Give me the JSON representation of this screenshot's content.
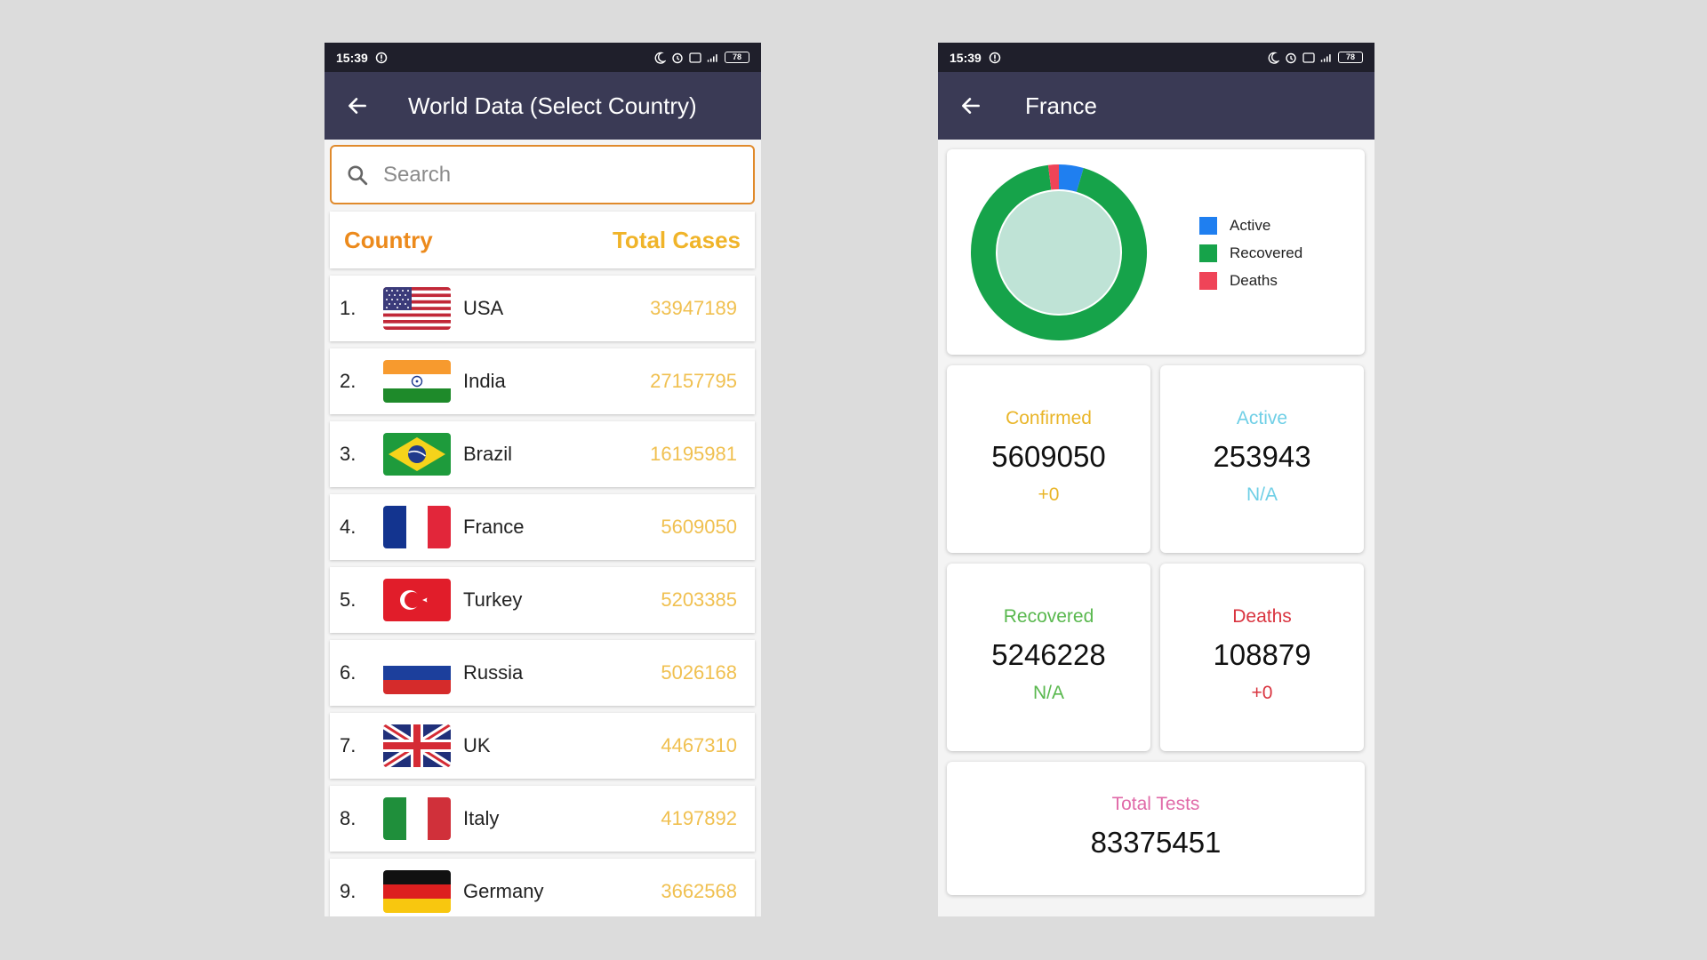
{
  "left": {
    "status": {
      "time": "15:39",
      "battery": "78"
    },
    "appbar": {
      "title": "World Data (Select Country)"
    },
    "search": {
      "placeholder": "Search"
    },
    "table_header": {
      "country": "Country",
      "total_cases": "Total Cases"
    },
    "countries": [
      {
        "rank": "1.",
        "name": "USA",
        "cases": "33947189",
        "flag": "usa-flag"
      },
      {
        "rank": "2.",
        "name": "India",
        "cases": "27157795",
        "flag": "india-flag"
      },
      {
        "rank": "3.",
        "name": "Brazil",
        "cases": "16195981",
        "flag": "brazil-flag"
      },
      {
        "rank": "4.",
        "name": "France",
        "cases": "5609050",
        "flag": "france-flag"
      },
      {
        "rank": "5.",
        "name": "Turkey",
        "cases": "5203385",
        "flag": "turkey-flag"
      },
      {
        "rank": "6.",
        "name": "Russia",
        "cases": "5026168",
        "flag": "russia-flag"
      },
      {
        "rank": "7.",
        "name": "UK",
        "cases": "4467310",
        "flag": "uk-flag"
      },
      {
        "rank": "8.",
        "name": "Italy",
        "cases": "4197892",
        "flag": "italy-flag"
      },
      {
        "rank": "9.",
        "name": "Germany",
        "cases": "3662568",
        "flag": "germany-flag"
      }
    ]
  },
  "right": {
    "status": {
      "time": "15:39",
      "battery": "78"
    },
    "appbar": {
      "title": "France"
    },
    "legend": {
      "active": "Active",
      "recovered": "Recovered",
      "deaths": "Deaths"
    },
    "stats": {
      "confirmed": {
        "label": "Confirmed",
        "value": "5609050",
        "delta": "+0"
      },
      "active": {
        "label": "Active",
        "value": "253943",
        "delta": "N/A"
      },
      "recovered": {
        "label": "Recovered",
        "value": "5246228",
        "delta": "N/A"
      },
      "deaths": {
        "label": "Deaths",
        "value": "108879",
        "delta": "+0"
      },
      "tests": {
        "label": "Total Tests",
        "value": "83375451"
      }
    }
  },
  "chart_data": {
    "type": "pie",
    "categories": [
      "Active",
      "Recovered",
      "Deaths"
    ],
    "values": [
      253943,
      5246228,
      108879
    ],
    "colors": [
      "#1f7ff0",
      "#16a34a",
      "#ef4458"
    ],
    "title": "",
    "legend_position": "right"
  },
  "colors": {
    "appbar": "#3a3a55",
    "statusbar": "#1f1f2b",
    "accent_orange": "#ec8a1c",
    "cases_yellow": "#f0c050",
    "confirmed": "#e9b528",
    "active": "#6fcfe6",
    "recovered": "#59b84e",
    "deaths": "#d9343f",
    "tests": "#e06aa8"
  }
}
